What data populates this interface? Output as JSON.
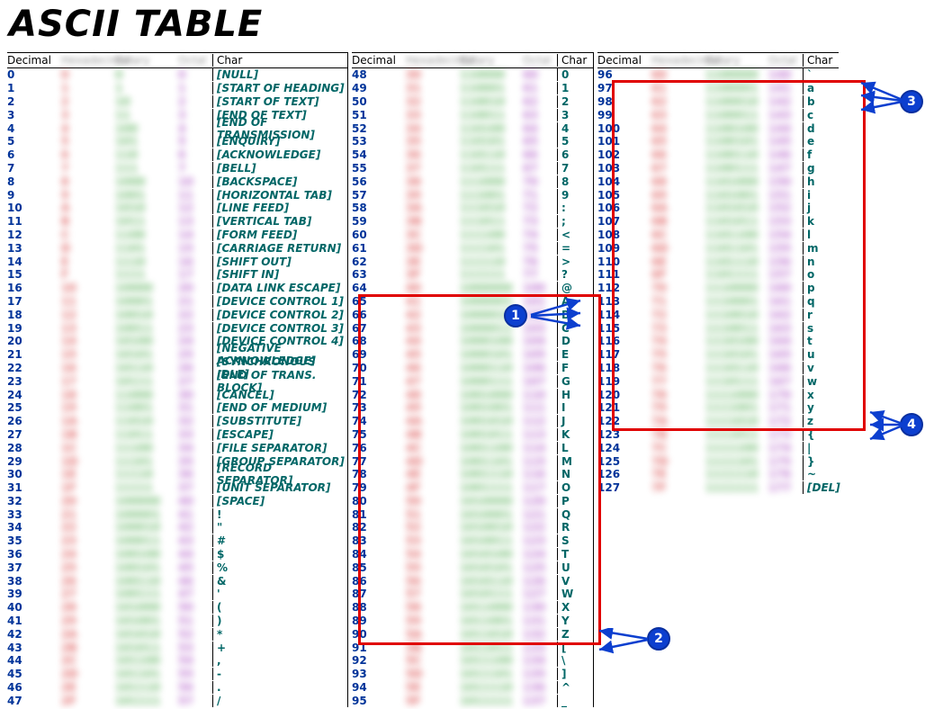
{
  "title": "ASCII TABLE",
  "headers": {
    "decimal": "Decimal",
    "hex": "Hexadecimal",
    "binary": "Binary",
    "octal": "Octal",
    "char": "Char"
  },
  "col1": [
    {
      "dec": "0",
      "hex": "0",
      "bin": "0",
      "oct": "0",
      "chr": "[NULL]",
      "ital": true
    },
    {
      "dec": "1",
      "hex": "1",
      "bin": "1",
      "oct": "1",
      "chr": "[START OF HEADING]",
      "ital": true
    },
    {
      "dec": "2",
      "hex": "2",
      "bin": "10",
      "oct": "2",
      "chr": "[START OF TEXT]",
      "ital": true
    },
    {
      "dec": "3",
      "hex": "3",
      "bin": "11",
      "oct": "3",
      "chr": "[END OF TEXT]",
      "ital": true
    },
    {
      "dec": "4",
      "hex": "4",
      "bin": "100",
      "oct": "4",
      "chr": "[END OF TRANSMISSION]",
      "ital": true
    },
    {
      "dec": "5",
      "hex": "5",
      "bin": "101",
      "oct": "5",
      "chr": "[ENQUIRY]",
      "ital": true
    },
    {
      "dec": "6",
      "hex": "6",
      "bin": "110",
      "oct": "6",
      "chr": "[ACKNOWLEDGE]",
      "ital": true
    },
    {
      "dec": "7",
      "hex": "7",
      "bin": "111",
      "oct": "7",
      "chr": "[BELL]",
      "ital": true
    },
    {
      "dec": "8",
      "hex": "8",
      "bin": "1000",
      "oct": "10",
      "chr": "[BACKSPACE]",
      "ital": true
    },
    {
      "dec": "9",
      "hex": "9",
      "bin": "1001",
      "oct": "11",
      "chr": "[HORIZONTAL TAB]",
      "ital": true
    },
    {
      "dec": "10",
      "hex": "A",
      "bin": "1010",
      "oct": "12",
      "chr": "[LINE FEED]",
      "ital": true
    },
    {
      "dec": "11",
      "hex": "B",
      "bin": "1011",
      "oct": "13",
      "chr": "[VERTICAL TAB]",
      "ital": true
    },
    {
      "dec": "12",
      "hex": "C",
      "bin": "1100",
      "oct": "14",
      "chr": "[FORM FEED]",
      "ital": true
    },
    {
      "dec": "13",
      "hex": "D",
      "bin": "1101",
      "oct": "15",
      "chr": "[CARRIAGE RETURN]",
      "ital": true
    },
    {
      "dec": "14",
      "hex": "E",
      "bin": "1110",
      "oct": "16",
      "chr": "[SHIFT OUT]",
      "ital": true
    },
    {
      "dec": "15",
      "hex": "F",
      "bin": "1111",
      "oct": "17",
      "chr": "[SHIFT IN]",
      "ital": true
    },
    {
      "dec": "16",
      "hex": "10",
      "bin": "10000",
      "oct": "20",
      "chr": "[DATA LINK ESCAPE]",
      "ital": true
    },
    {
      "dec": "17",
      "hex": "11",
      "bin": "10001",
      "oct": "21",
      "chr": "[DEVICE CONTROL 1]",
      "ital": true
    },
    {
      "dec": "18",
      "hex": "12",
      "bin": "10010",
      "oct": "22",
      "chr": "[DEVICE CONTROL 2]",
      "ital": true
    },
    {
      "dec": "19",
      "hex": "13",
      "bin": "10011",
      "oct": "23",
      "chr": "[DEVICE CONTROL 3]",
      "ital": true
    },
    {
      "dec": "20",
      "hex": "14",
      "bin": "10100",
      "oct": "24",
      "chr": "[DEVICE CONTROL 4]",
      "ital": true
    },
    {
      "dec": "21",
      "hex": "15",
      "bin": "10101",
      "oct": "25",
      "chr": "[NEGATIVE ACKNOWLEDGE]",
      "ital": true
    },
    {
      "dec": "22",
      "hex": "16",
      "bin": "10110",
      "oct": "26",
      "chr": "[SYNCHRONOUS IDLE]",
      "ital": true
    },
    {
      "dec": "23",
      "hex": "17",
      "bin": "10111",
      "oct": "27",
      "chr": "[END OF TRANS. BLOCK]",
      "ital": true
    },
    {
      "dec": "24",
      "hex": "18",
      "bin": "11000",
      "oct": "30",
      "chr": "[CANCEL]",
      "ital": true
    },
    {
      "dec": "25",
      "hex": "19",
      "bin": "11001",
      "oct": "31",
      "chr": "[END OF MEDIUM]",
      "ital": true
    },
    {
      "dec": "26",
      "hex": "1A",
      "bin": "11010",
      "oct": "32",
      "chr": "[SUBSTITUTE]",
      "ital": true
    },
    {
      "dec": "27",
      "hex": "1B",
      "bin": "11011",
      "oct": "33",
      "chr": "[ESCAPE]",
      "ital": true
    },
    {
      "dec": "28",
      "hex": "1C",
      "bin": "11100",
      "oct": "34",
      "chr": "[FILE SEPARATOR]",
      "ital": true
    },
    {
      "dec": "29",
      "hex": "1D",
      "bin": "11101",
      "oct": "35",
      "chr": "[GROUP SEPARATOR]",
      "ital": true
    },
    {
      "dec": "30",
      "hex": "1E",
      "bin": "11110",
      "oct": "36",
      "chr": "[RECORD SEPARATOR]",
      "ital": true
    },
    {
      "dec": "31",
      "hex": "1F",
      "bin": "11111",
      "oct": "37",
      "chr": "[UNIT SEPARATOR]",
      "ital": true
    },
    {
      "dec": "32",
      "hex": "20",
      "bin": "100000",
      "oct": "40",
      "chr": "[SPACE]",
      "ital": true
    },
    {
      "dec": "33",
      "hex": "21",
      "bin": "100001",
      "oct": "41",
      "chr": "!",
      "ital": false
    },
    {
      "dec": "34",
      "hex": "22",
      "bin": "100010",
      "oct": "42",
      "chr": "\"",
      "ital": false
    },
    {
      "dec": "35",
      "hex": "23",
      "bin": "100011",
      "oct": "43",
      "chr": "#",
      "ital": false
    },
    {
      "dec": "36",
      "hex": "24",
      "bin": "100100",
      "oct": "44",
      "chr": "$",
      "ital": false
    },
    {
      "dec": "37",
      "hex": "25",
      "bin": "100101",
      "oct": "45",
      "chr": "%",
      "ital": false
    },
    {
      "dec": "38",
      "hex": "26",
      "bin": "100110",
      "oct": "46",
      "chr": "&",
      "ital": false
    },
    {
      "dec": "39",
      "hex": "27",
      "bin": "100111",
      "oct": "47",
      "chr": "'",
      "ital": false
    },
    {
      "dec": "40",
      "hex": "28",
      "bin": "101000",
      "oct": "50",
      "chr": "(",
      "ital": false
    },
    {
      "dec": "41",
      "hex": "29",
      "bin": "101001",
      "oct": "51",
      "chr": ")",
      "ital": false
    },
    {
      "dec": "42",
      "hex": "2A",
      "bin": "101010",
      "oct": "52",
      "chr": "*",
      "ital": false
    },
    {
      "dec": "43",
      "hex": "2B",
      "bin": "101011",
      "oct": "53",
      "chr": "+",
      "ital": false
    },
    {
      "dec": "44",
      "hex": "2C",
      "bin": "101100",
      "oct": "54",
      "chr": ",",
      "ital": false
    },
    {
      "dec": "45",
      "hex": "2D",
      "bin": "101101",
      "oct": "55",
      "chr": "-",
      "ital": false
    },
    {
      "dec": "46",
      "hex": "2E",
      "bin": "101110",
      "oct": "56",
      "chr": ".",
      "ital": false
    },
    {
      "dec": "47",
      "hex": "2F",
      "bin": "101111",
      "oct": "57",
      "chr": "/",
      "ital": false
    }
  ],
  "col2": [
    {
      "dec": "48",
      "hex": "30",
      "bin": "110000",
      "oct": "60",
      "chr": "0"
    },
    {
      "dec": "49",
      "hex": "31",
      "bin": "110001",
      "oct": "61",
      "chr": "1"
    },
    {
      "dec": "50",
      "hex": "32",
      "bin": "110010",
      "oct": "62",
      "chr": "2"
    },
    {
      "dec": "51",
      "hex": "33",
      "bin": "110011",
      "oct": "63",
      "chr": "3"
    },
    {
      "dec": "52",
      "hex": "34",
      "bin": "110100",
      "oct": "64",
      "chr": "4"
    },
    {
      "dec": "53",
      "hex": "35",
      "bin": "110101",
      "oct": "65",
      "chr": "5"
    },
    {
      "dec": "54",
      "hex": "36",
      "bin": "110110",
      "oct": "66",
      "chr": "6"
    },
    {
      "dec": "55",
      "hex": "37",
      "bin": "110111",
      "oct": "67",
      "chr": "7"
    },
    {
      "dec": "56",
      "hex": "38",
      "bin": "111000",
      "oct": "70",
      "chr": "8"
    },
    {
      "dec": "57",
      "hex": "39",
      "bin": "111001",
      "oct": "71",
      "chr": "9"
    },
    {
      "dec": "58",
      "hex": "3A",
      "bin": "111010",
      "oct": "72",
      "chr": ":"
    },
    {
      "dec": "59",
      "hex": "3B",
      "bin": "111011",
      "oct": "73",
      "chr": ";"
    },
    {
      "dec": "60",
      "hex": "3C",
      "bin": "111100",
      "oct": "74",
      "chr": "<"
    },
    {
      "dec": "61",
      "hex": "3D",
      "bin": "111101",
      "oct": "75",
      "chr": "="
    },
    {
      "dec": "62",
      "hex": "3E",
      "bin": "111110",
      "oct": "76",
      "chr": ">"
    },
    {
      "dec": "63",
      "hex": "3F",
      "bin": "111111",
      "oct": "77",
      "chr": "?"
    },
    {
      "dec": "64",
      "hex": "40",
      "bin": "1000000",
      "oct": "100",
      "chr": "@"
    },
    {
      "dec": "65",
      "hex": "41",
      "bin": "1000001",
      "oct": "101",
      "chr": "A"
    },
    {
      "dec": "66",
      "hex": "42",
      "bin": "1000010",
      "oct": "102",
      "chr": "B"
    },
    {
      "dec": "67",
      "hex": "43",
      "bin": "1000011",
      "oct": "103",
      "chr": "C"
    },
    {
      "dec": "68",
      "hex": "44",
      "bin": "1000100",
      "oct": "104",
      "chr": "D"
    },
    {
      "dec": "69",
      "hex": "45",
      "bin": "1000101",
      "oct": "105",
      "chr": "E"
    },
    {
      "dec": "70",
      "hex": "46",
      "bin": "1000110",
      "oct": "106",
      "chr": "F"
    },
    {
      "dec": "71",
      "hex": "47",
      "bin": "1000111",
      "oct": "107",
      "chr": "G"
    },
    {
      "dec": "72",
      "hex": "48",
      "bin": "1001000",
      "oct": "110",
      "chr": "H"
    },
    {
      "dec": "73",
      "hex": "49",
      "bin": "1001001",
      "oct": "111",
      "chr": "I"
    },
    {
      "dec": "74",
      "hex": "4A",
      "bin": "1001010",
      "oct": "112",
      "chr": "J"
    },
    {
      "dec": "75",
      "hex": "4B",
      "bin": "1001011",
      "oct": "113",
      "chr": "K"
    },
    {
      "dec": "76",
      "hex": "4C",
      "bin": "1001100",
      "oct": "114",
      "chr": "L"
    },
    {
      "dec": "77",
      "hex": "4D",
      "bin": "1001101",
      "oct": "115",
      "chr": "M"
    },
    {
      "dec": "78",
      "hex": "4E",
      "bin": "1001110",
      "oct": "116",
      "chr": "N"
    },
    {
      "dec": "79",
      "hex": "4F",
      "bin": "1001111",
      "oct": "117",
      "chr": "O"
    },
    {
      "dec": "80",
      "hex": "50",
      "bin": "1010000",
      "oct": "120",
      "chr": "P"
    },
    {
      "dec": "81",
      "hex": "51",
      "bin": "1010001",
      "oct": "121",
      "chr": "Q"
    },
    {
      "dec": "82",
      "hex": "52",
      "bin": "1010010",
      "oct": "122",
      "chr": "R"
    },
    {
      "dec": "83",
      "hex": "53",
      "bin": "1010011",
      "oct": "123",
      "chr": "S"
    },
    {
      "dec": "84",
      "hex": "54",
      "bin": "1010100",
      "oct": "124",
      "chr": "T"
    },
    {
      "dec": "85",
      "hex": "55",
      "bin": "1010101",
      "oct": "125",
      "chr": "U"
    },
    {
      "dec": "86",
      "hex": "56",
      "bin": "1010110",
      "oct": "126",
      "chr": "V"
    },
    {
      "dec": "87",
      "hex": "57",
      "bin": "1010111",
      "oct": "127",
      "chr": "W"
    },
    {
      "dec": "88",
      "hex": "58",
      "bin": "1011000",
      "oct": "130",
      "chr": "X"
    },
    {
      "dec": "89",
      "hex": "59",
      "bin": "1011001",
      "oct": "131",
      "chr": "Y"
    },
    {
      "dec": "90",
      "hex": "5A",
      "bin": "1011010",
      "oct": "132",
      "chr": "Z"
    },
    {
      "dec": "91",
      "hex": "5B",
      "bin": "1011011",
      "oct": "133",
      "chr": "["
    },
    {
      "dec": "92",
      "hex": "5C",
      "bin": "1011100",
      "oct": "134",
      "chr": "\\"
    },
    {
      "dec": "93",
      "hex": "5D",
      "bin": "1011101",
      "oct": "135",
      "chr": "]"
    },
    {
      "dec": "94",
      "hex": "5E",
      "bin": "1011110",
      "oct": "136",
      "chr": "^"
    },
    {
      "dec": "95",
      "hex": "5F",
      "bin": "1011111",
      "oct": "137",
      "chr": "_"
    }
  ],
  "col3": [
    {
      "dec": "96",
      "hex": "60",
      "bin": "1100000",
      "oct": "140",
      "chr": "`"
    },
    {
      "dec": "97",
      "hex": "61",
      "bin": "1100001",
      "oct": "141",
      "chr": "a"
    },
    {
      "dec": "98",
      "hex": "62",
      "bin": "1100010",
      "oct": "142",
      "chr": "b"
    },
    {
      "dec": "99",
      "hex": "63",
      "bin": "1100011",
      "oct": "143",
      "chr": "c"
    },
    {
      "dec": "100",
      "hex": "64",
      "bin": "1100100",
      "oct": "144",
      "chr": "d"
    },
    {
      "dec": "101",
      "hex": "65",
      "bin": "1100101",
      "oct": "145",
      "chr": "e"
    },
    {
      "dec": "102",
      "hex": "66",
      "bin": "1100110",
      "oct": "146",
      "chr": "f"
    },
    {
      "dec": "103",
      "hex": "67",
      "bin": "1100111",
      "oct": "147",
      "chr": "g"
    },
    {
      "dec": "104",
      "hex": "68",
      "bin": "1101000",
      "oct": "150",
      "chr": "h"
    },
    {
      "dec": "105",
      "hex": "69",
      "bin": "1101001",
      "oct": "151",
      "chr": "i"
    },
    {
      "dec": "106",
      "hex": "6A",
      "bin": "1101010",
      "oct": "152",
      "chr": "j"
    },
    {
      "dec": "107",
      "hex": "6B",
      "bin": "1101011",
      "oct": "153",
      "chr": "k"
    },
    {
      "dec": "108",
      "hex": "6C",
      "bin": "1101100",
      "oct": "154",
      "chr": "l"
    },
    {
      "dec": "109",
      "hex": "6D",
      "bin": "1101101",
      "oct": "155",
      "chr": "m"
    },
    {
      "dec": "110",
      "hex": "6E",
      "bin": "1101110",
      "oct": "156",
      "chr": "n"
    },
    {
      "dec": "111",
      "hex": "6F",
      "bin": "1101111",
      "oct": "157",
      "chr": "o"
    },
    {
      "dec": "112",
      "hex": "70",
      "bin": "1110000",
      "oct": "160",
      "chr": "p"
    },
    {
      "dec": "113",
      "hex": "71",
      "bin": "1110001",
      "oct": "161",
      "chr": "q"
    },
    {
      "dec": "114",
      "hex": "72",
      "bin": "1110010",
      "oct": "162",
      "chr": "r"
    },
    {
      "dec": "115",
      "hex": "73",
      "bin": "1110011",
      "oct": "163",
      "chr": "s"
    },
    {
      "dec": "116",
      "hex": "74",
      "bin": "1110100",
      "oct": "164",
      "chr": "t"
    },
    {
      "dec": "117",
      "hex": "75",
      "bin": "1110101",
      "oct": "165",
      "chr": "u"
    },
    {
      "dec": "118",
      "hex": "76",
      "bin": "1110110",
      "oct": "166",
      "chr": "v"
    },
    {
      "dec": "119",
      "hex": "77",
      "bin": "1110111",
      "oct": "167",
      "chr": "w"
    },
    {
      "dec": "120",
      "hex": "78",
      "bin": "1111000",
      "oct": "170",
      "chr": "x"
    },
    {
      "dec": "121",
      "hex": "79",
      "bin": "1111001",
      "oct": "171",
      "chr": "y"
    },
    {
      "dec": "122",
      "hex": "7A",
      "bin": "1111010",
      "oct": "172",
      "chr": "z"
    },
    {
      "dec": "123",
      "hex": "7B",
      "bin": "1111011",
      "oct": "173",
      "chr": "{"
    },
    {
      "dec": "124",
      "hex": "7C",
      "bin": "1111100",
      "oct": "174",
      "chr": "|"
    },
    {
      "dec": "125",
      "hex": "7D",
      "bin": "1111101",
      "oct": "175",
      "chr": "}"
    },
    {
      "dec": "126",
      "hex": "7E",
      "bin": "1111110",
      "oct": "176",
      "chr": "~"
    },
    {
      "dec": "127",
      "hex": "7F",
      "bin": "1111111",
      "oct": "177",
      "chr": "[DEL]",
      "ital": true
    }
  ],
  "callouts": {
    "c1": "1",
    "c2": "2",
    "c3": "3",
    "c4": "4"
  }
}
